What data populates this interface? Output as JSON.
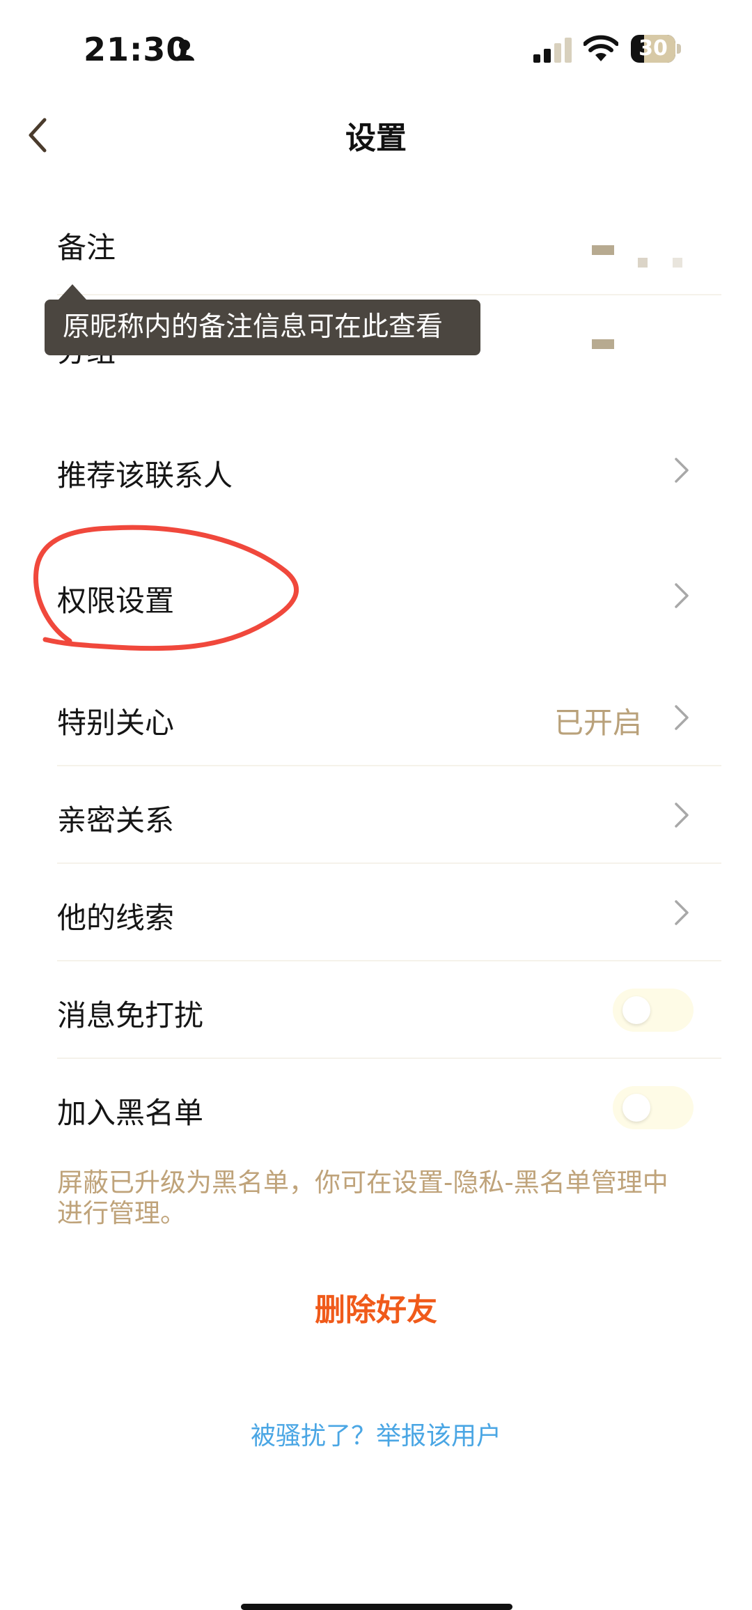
{
  "status_bar": {
    "time": "21:30",
    "battery": "30",
    "battery_level": 0.3
  },
  "nav": {
    "title": "设置"
  },
  "rows": {
    "remark": {
      "label": "备注"
    },
    "group": {
      "label": "分组"
    },
    "recommend": {
      "label": "推荐该联系人"
    },
    "permissions": {
      "label": "权限设置"
    },
    "special_care": {
      "label": "特别关心",
      "value": "已开启"
    },
    "intimacy": {
      "label": "亲密关系"
    },
    "clues": {
      "label": "他的线索"
    },
    "do_not_disturb": {
      "label": "消息免打扰",
      "enabled": false
    },
    "blacklist": {
      "label": "加入黑名单",
      "enabled": false
    }
  },
  "tooltip": {
    "text": "原昵称内的备注信息可在此查看"
  },
  "hint": {
    "text": "屏蔽已升级为黑名单，你可在设置-隐私-黑名单管理中进行管理。"
  },
  "delete_button": {
    "label": "删除好友"
  },
  "report_link": {
    "label": "被骚扰了？举报该用户"
  },
  "colors": {
    "delete": "#f05a1a",
    "link": "#4aa6e4",
    "muted": "#b9a17a",
    "annotation": "#f0483c",
    "tooltip_bg": "#4b4640"
  }
}
